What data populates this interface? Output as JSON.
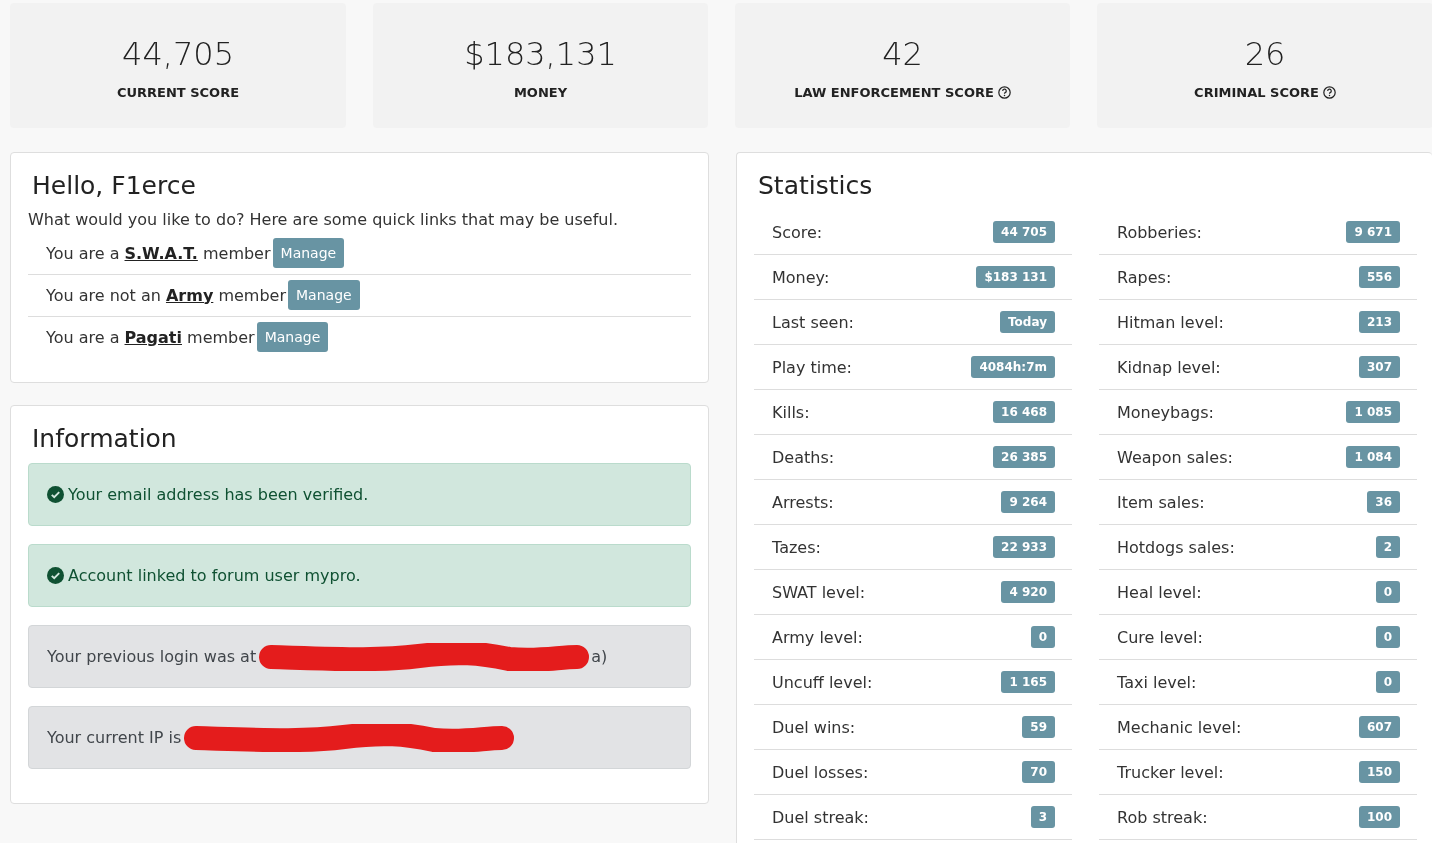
{
  "score_cards": [
    {
      "value": "44,705",
      "label": "CURRENT SCORE",
      "help": false
    },
    {
      "value": "$183,131",
      "label": "MONEY",
      "help": false
    },
    {
      "value": "42",
      "label": "LAW ENFORCEMENT SCORE",
      "help": true
    },
    {
      "value": "26",
      "label": "CRIMINAL SCORE",
      "help": true
    }
  ],
  "hello": {
    "title": "Hello, F1erce",
    "intro": "What would you like to do? Here are some quick links that may be useful.",
    "memberships": [
      {
        "before": "You are a",
        "group": "S.W.A.T.",
        "after": "member",
        "button": "Manage"
      },
      {
        "before": "You are not an",
        "group": "Army",
        "after": "member",
        "button": "Manage"
      },
      {
        "before": "You are a",
        "group": "Pagati",
        "after": "member",
        "button": "Manage"
      }
    ]
  },
  "information": {
    "title": "Information",
    "alerts": [
      {
        "kind": "success",
        "text": "Your email address has been verified.",
        "redacted": false
      },
      {
        "kind": "success",
        "text": "Account linked to forum user mypro.",
        "redacted": false
      },
      {
        "kind": "secondary",
        "text": "Your previous login was at",
        "tail": "a)",
        "redacted": true
      },
      {
        "kind": "secondary",
        "text": "Your current IP is",
        "redacted": true
      }
    ]
  },
  "statistics": {
    "title": "Statistics",
    "columns": [
      [
        {
          "label": "Score:",
          "value": "44 705"
        },
        {
          "label": "Money:",
          "value": "$183 131"
        },
        {
          "label": "Last seen:",
          "value": "Today"
        },
        {
          "label": "Play time:",
          "value": "4084h:7m"
        },
        {
          "label": "Kills:",
          "value": "16 468"
        },
        {
          "label": "Deaths:",
          "value": "26 385"
        },
        {
          "label": "Arrests:",
          "value": "9 264"
        },
        {
          "label": "Tazes:",
          "value": "22 933"
        },
        {
          "label": "SWAT level:",
          "value": "4 920"
        },
        {
          "label": "Army level:",
          "value": "0"
        },
        {
          "label": "Uncuff level:",
          "value": "1 165"
        },
        {
          "label": "Duel wins:",
          "value": "59"
        },
        {
          "label": "Duel losses:",
          "value": "70"
        },
        {
          "label": "Duel streak:",
          "value": "3"
        }
      ],
      [
        {
          "label": "Robberies:",
          "value": "9 671"
        },
        {
          "label": "Rapes:",
          "value": "556"
        },
        {
          "label": "Hitman level:",
          "value": "213"
        },
        {
          "label": "Kidnap level:",
          "value": "307"
        },
        {
          "label": "Moneybags:",
          "value": "1 085"
        },
        {
          "label": "Weapon sales:",
          "value": "1 084"
        },
        {
          "label": "Item sales:",
          "value": "36"
        },
        {
          "label": "Hotdogs sales:",
          "value": "2"
        },
        {
          "label": "Heal level:",
          "value": "0"
        },
        {
          "label": "Cure level:",
          "value": "0"
        },
        {
          "label": "Taxi level:",
          "value": "0"
        },
        {
          "label": "Mechanic level:",
          "value": "607"
        },
        {
          "label": "Trucker level:",
          "value": "150"
        },
        {
          "label": "Rob streak:",
          "value": "100"
        }
      ]
    ]
  }
}
